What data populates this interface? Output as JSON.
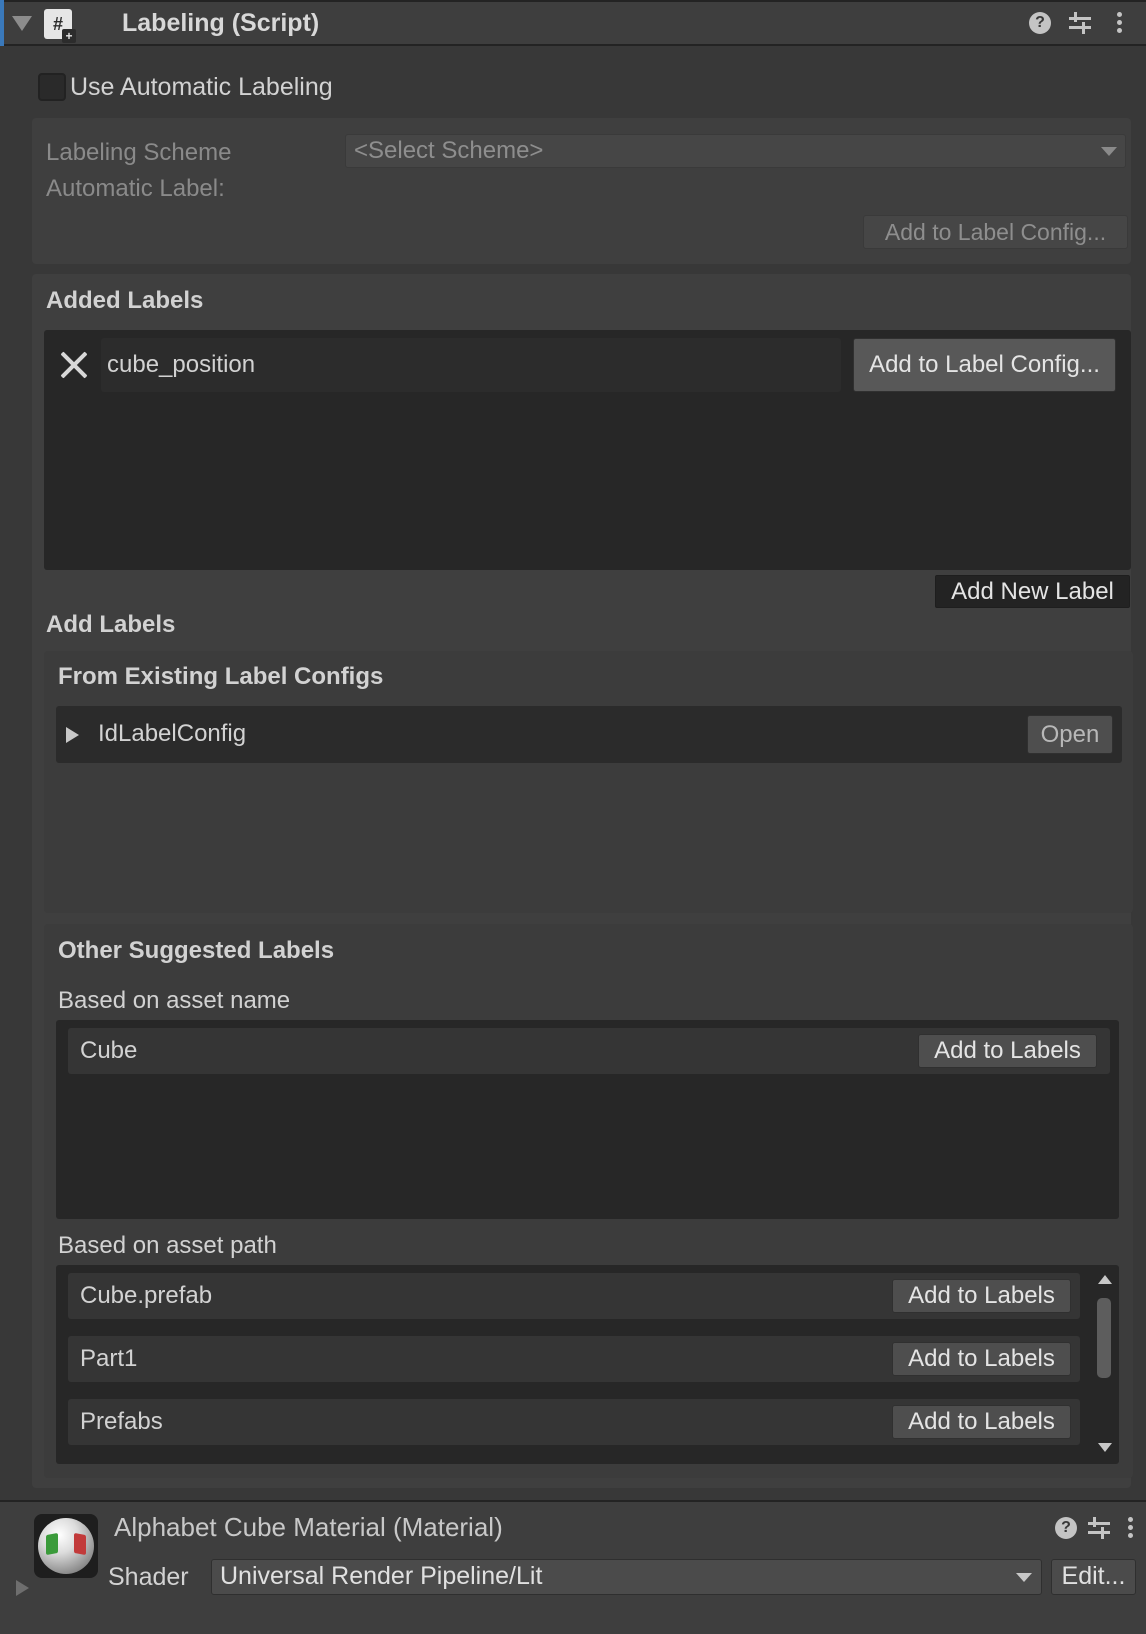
{
  "component": {
    "title": "Labeling (Script)",
    "icons": [
      "script-icon",
      "help-icon",
      "presets-icon",
      "more-icon"
    ]
  },
  "auto_labeling": {
    "toggle_label": "Use Automatic Labeling",
    "checked": false,
    "scheme_label": "Labeling Scheme",
    "scheme_value": "<Select Scheme>",
    "automatic_label": "Automatic Label:",
    "add_to_config": "Add to Label Config..."
  },
  "added_labels": {
    "heading": "Added Labels",
    "items": [
      {
        "value": "cube_position",
        "add_button": "Add to Label Config..."
      }
    ],
    "add_new_label": "Add New Label"
  },
  "add_labels": {
    "heading": "Add Labels",
    "existing": {
      "heading": "From Existing Label Configs",
      "items": [
        {
          "name": "IdLabelConfig",
          "open_button": "Open"
        }
      ]
    },
    "suggested": {
      "heading": "Other Suggested Labels",
      "by_name": {
        "heading": "Based on asset name",
        "items": [
          {
            "name": "Cube",
            "button": "Add to Labels"
          }
        ]
      },
      "by_path": {
        "heading": "Based on asset path",
        "items": [
          {
            "name": "Cube.prefab",
            "button": "Add to Labels"
          },
          {
            "name": "Part1",
            "button": "Add to Labels"
          },
          {
            "name": "Prefabs",
            "button": "Add to Labels"
          }
        ]
      }
    }
  },
  "material": {
    "title": "Alphabet Cube Material (Material)",
    "shader_label": "Shader",
    "shader_value": "Universal Render Pipeline/Lit",
    "edit_button": "Edit..."
  },
  "colors": {
    "panel_bg": "#383838",
    "accent": "#3a79bb",
    "list_bg": "#272727"
  }
}
